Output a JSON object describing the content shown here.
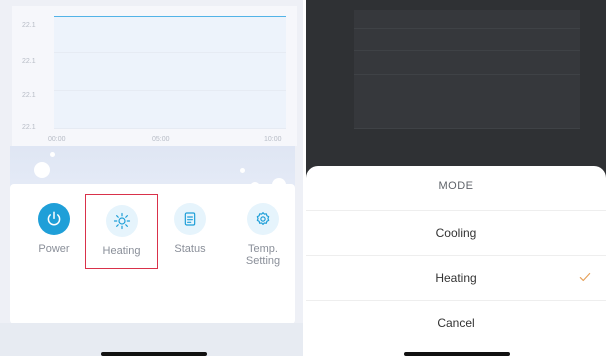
{
  "left_screen": {
    "chart": {
      "y_ticks": [
        "22.1",
        "22.1",
        "22.1",
        "22.1"
      ],
      "x_ticks": [
        "00:00",
        "05:00",
        "10:00"
      ]
    },
    "controls": {
      "power_label": "Power",
      "heating_label": "Heating",
      "status_label": "Status",
      "temp_setting_label": "Temp. Setting"
    },
    "accent_color": "#1f9fd8",
    "highlight_color": "#d9314a"
  },
  "right_screen": {
    "mode_sheet": {
      "title": "MODE",
      "options": [
        {
          "label": "Cooling",
          "selected": false
        },
        {
          "label": "Heating",
          "selected": true
        }
      ],
      "cancel_label": "Cancel",
      "check_color": "#e6a15a"
    }
  }
}
